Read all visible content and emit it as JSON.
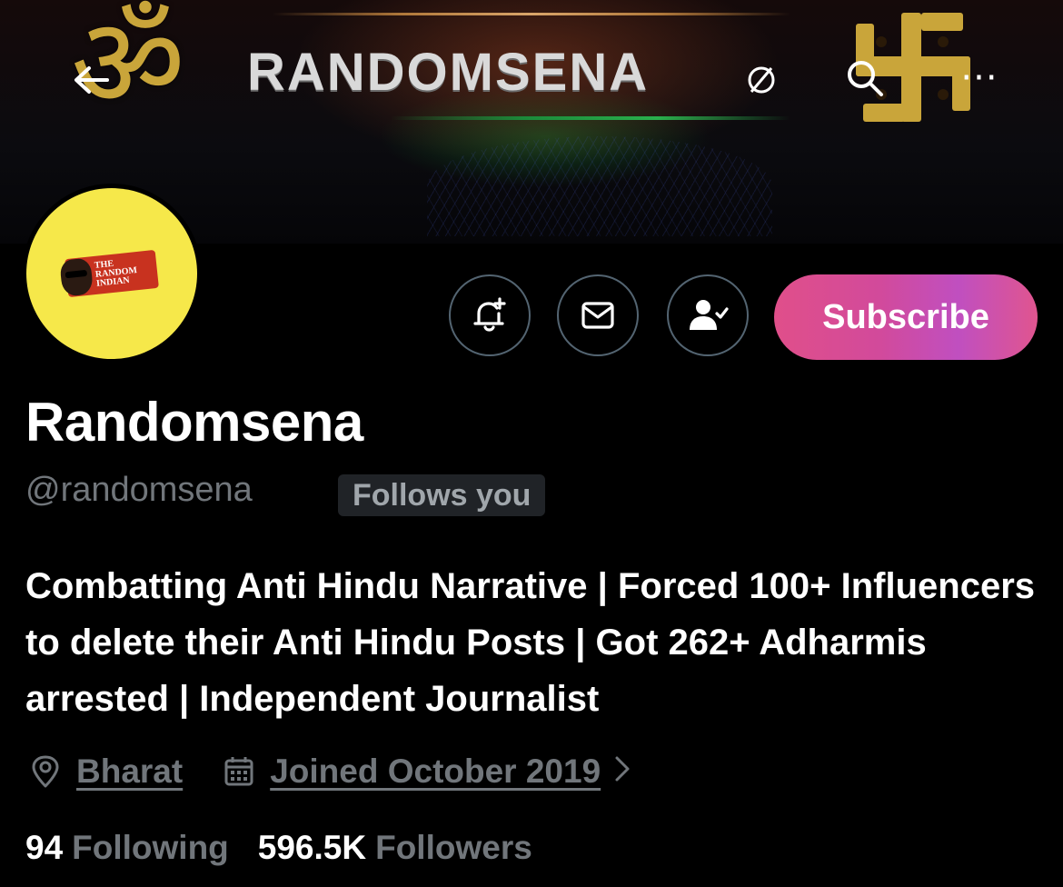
{
  "header": {
    "banner_title": "RANDOMSENA",
    "om_symbol": "ॐ",
    "back_icon": "arrow-left-icon",
    "search_icon": "search-icon",
    "more_icon": "more-horizontal-icon",
    "more_glyph": "···"
  },
  "profile": {
    "avatar_text_1": "THE",
    "avatar_text_2": "RANDOM",
    "avatar_text_3": "INDIAN",
    "display_name": "Randomsena",
    "handle": "@randomsena",
    "follows_you_badge": "Follows you",
    "bio": "Combatting Anti Hindu Narrative | Forced 100+ Influencers to delete their Anti Hindu Posts | Got 262+ Adharmis arrested | Independent Journalist",
    "location": "Bharat",
    "joined": "Joined October 2019"
  },
  "actions": {
    "notify_icon": "bell-plus-icon",
    "message_icon": "envelope-icon",
    "following_icon": "person-check-icon",
    "subscribe_label": "Subscribe"
  },
  "stats": {
    "following_count": "94",
    "following_label": "Following",
    "followers_count": "596.5K",
    "followers_label": "Followers"
  },
  "colors": {
    "background": "#000000",
    "secondary_text": "#71767b",
    "subscribe_gradient_start": "#e04f8a",
    "subscribe_gradient_end": "#c04fc0",
    "avatar_yellow": "#f6e84a",
    "border": "#536471"
  }
}
